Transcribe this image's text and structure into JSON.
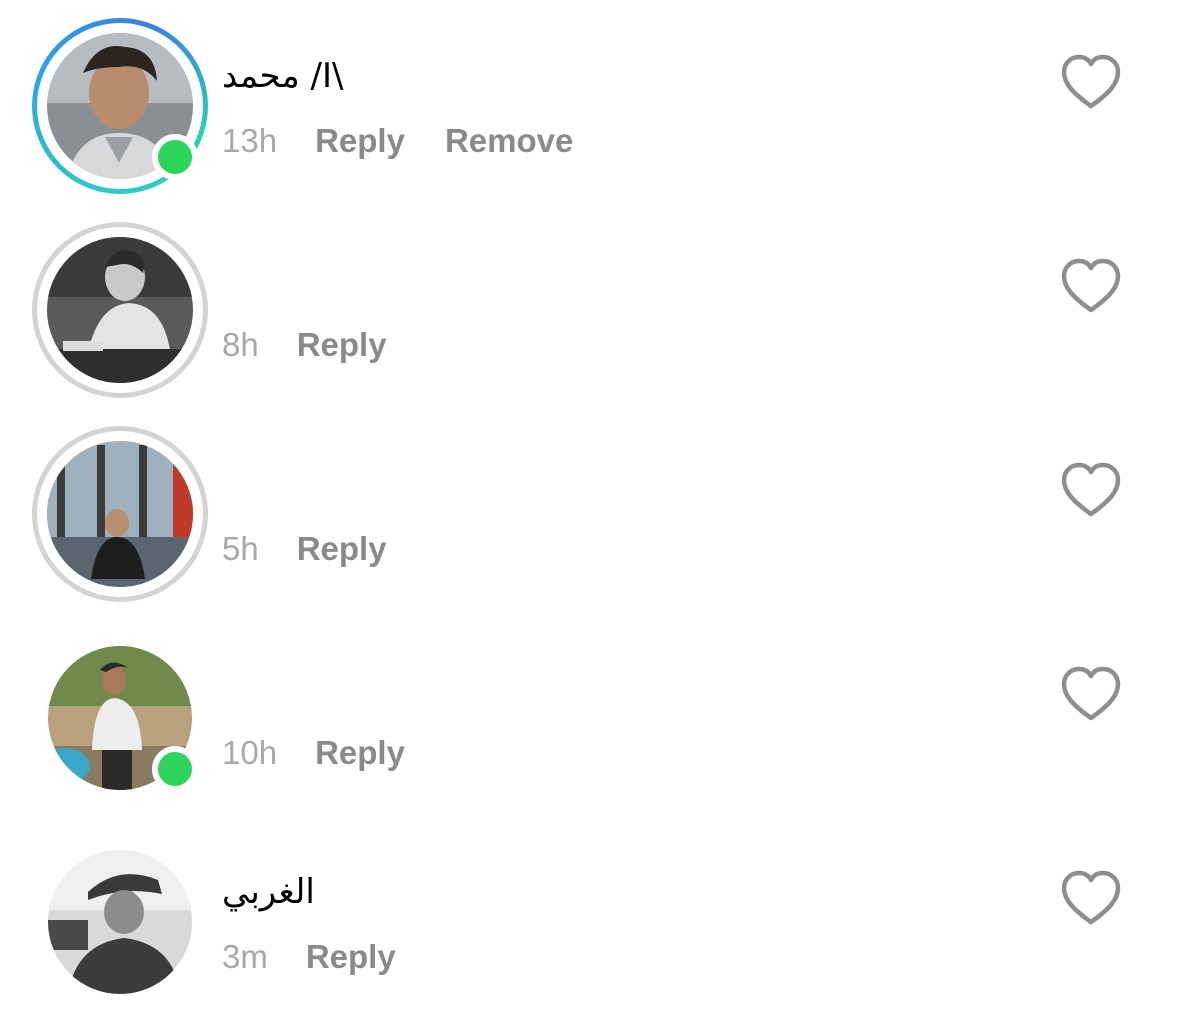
{
  "comments": [
    {
      "username": "\\I/ محمد",
      "time": "13h",
      "actions": [
        "Reply",
        "Remove"
      ],
      "story_ring": "unseen",
      "online": true,
      "avatar_icon": "user-avatar-photo"
    },
    {
      "username": "",
      "time": "8h",
      "actions": [
        "Reply"
      ],
      "story_ring": "seen",
      "online": false,
      "avatar_icon": "user-avatar-photo"
    },
    {
      "username": "",
      "time": "5h",
      "actions": [
        "Reply"
      ],
      "story_ring": "seen",
      "online": false,
      "avatar_icon": "user-avatar-photo"
    },
    {
      "username": "",
      "time": "10h",
      "actions": [
        "Reply"
      ],
      "story_ring": "none",
      "online": true,
      "avatar_icon": "user-avatar-photo"
    },
    {
      "username": "الغربي",
      "time": "3m",
      "actions": [
        "Reply"
      ],
      "story_ring": "none",
      "online": false,
      "avatar_icon": "user-avatar-photo"
    }
  ],
  "colors": {
    "time": "#a8a8a8",
    "action": "#8a8a8a",
    "online": "#2dd45a",
    "heart_outline": "#8e8e8e",
    "seen_ring": "#d4d4d4"
  },
  "icons": {
    "like": "heart-outline-icon",
    "presence": "online-status-icon"
  }
}
